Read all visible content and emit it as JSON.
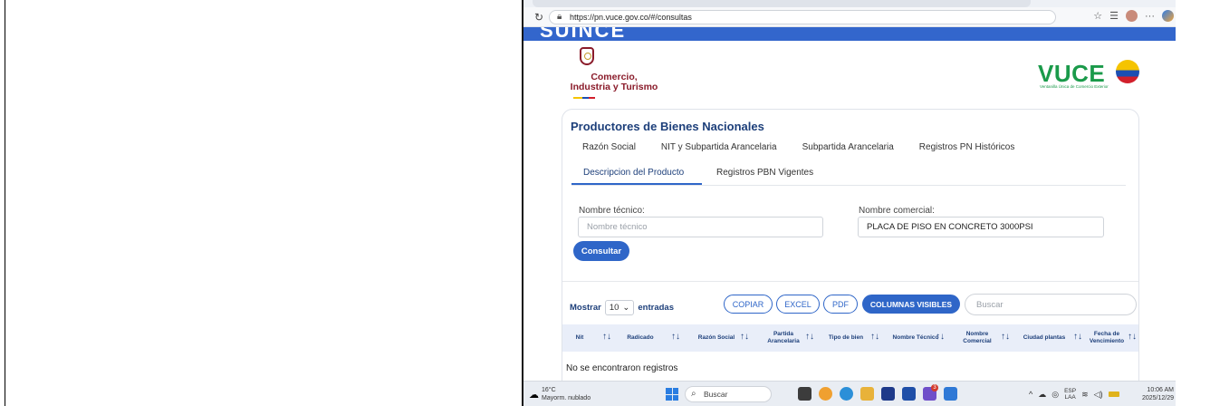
{
  "browser": {
    "url": "https://pn.vuce.gov.co/#/consultas",
    "reload_icon": "reload-icon",
    "lock_icon": "lock-icon"
  },
  "header": {
    "partial_text": "SUINCE",
    "ministry_line1": "Comercio,",
    "ministry_line2": "Industria y Turismo",
    "vuce_logo": "VUCE",
    "vuce_tagline": "Ventanilla Única de Comercio Exterior"
  },
  "card": {
    "title": "Productores de Bienes Nacionales",
    "tabs_row1": [
      "Razón Social",
      "NIT y Subpartida Arancelaria",
      "Subpartida Arancelaria",
      "Registros PN Históricos"
    ],
    "tabs_row2": [
      "Descripcion del Producto",
      "Registros PBN Vigentes"
    ],
    "active_tab": "Descripcion del Producto"
  },
  "form": {
    "nombre_tecnico_label": "Nombre técnico:",
    "nombre_tecnico_placeholder": "Nombre técnico",
    "nombre_tecnico_value": "",
    "nombre_comercial_label": "Nombre comercial:",
    "nombre_comercial_value": "PLACA DE PISO EN CONCRETO 3000PSI",
    "consultar_label": "Consultar"
  },
  "table_controls": {
    "mostrar_label": "Mostrar",
    "entries_value": "10",
    "entradas_label": "entradas",
    "buttons": [
      "COPIAR",
      "EXCEL",
      "PDF",
      "COLUMNAS VISIBLES"
    ],
    "search_placeholder": "Buscar"
  },
  "table": {
    "headers": [
      "Nit",
      "Radicado",
      "Razón Social",
      "Partida Arancelaria",
      "Tipo de bien",
      "Nombre Técnico",
      "Nombre Comercial",
      "Ciudad plantas",
      "Fecha de Vencimiento"
    ],
    "sort_icon": "↑↓",
    "empty_message": "No se encontraron registros"
  },
  "taskbar": {
    "temperature": "16°C",
    "weather": "Mayorm. nublado",
    "search_label": "Buscar",
    "lang_line1": "ESP",
    "lang_line2": "LAA",
    "time": "10:06 AM",
    "date": "2025/12/29",
    "notification_count": "3"
  },
  "colors": {
    "primary": "#2f66c8",
    "title": "#1d3f7a",
    "ministry": "#8a1b2a",
    "vuce_green": "#1a9a4a",
    "header_bar": "#3366cc"
  }
}
